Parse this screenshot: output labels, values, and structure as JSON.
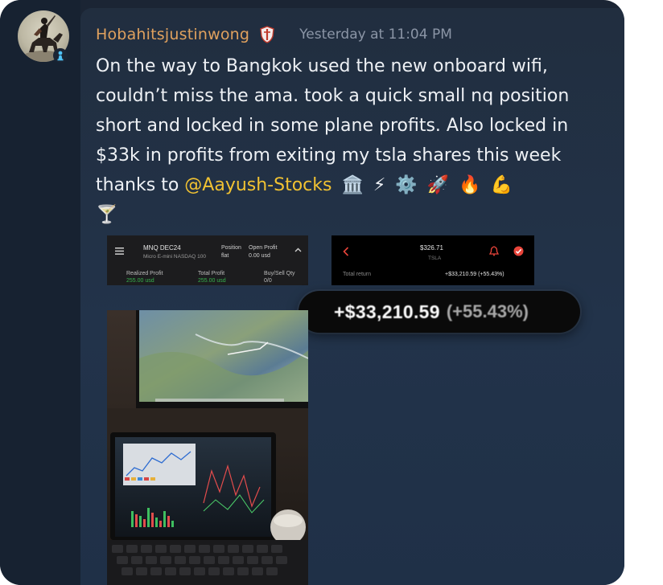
{
  "user": {
    "avatar_icon": "knight-on-horse-avatar",
    "username": "Hobahitsjustinwong",
    "username_color": "#e0a15e",
    "role_badge_icon": "shield-badge-icon",
    "timestamp": "Yesterday at 11:04 PM"
  },
  "message": {
    "text_before_mention": "On the way to Bangkok used the new onboard wifi, couldn’t miss the ama. took a quick small nq position short and locked in some plane profits. Also locked in $33k in profits from exiting my tsla shares this week thanks to ",
    "mention": "@Aayush-Stocks",
    "mention_color": "#f1c232",
    "emojis": [
      "🏛️",
      "⚡",
      "⚙️",
      "🚀",
      "🔥",
      "💪",
      "🍸"
    ]
  },
  "attachment_futures": {
    "menu_icon": "hamburger-menu-icon",
    "symbol": "MNQ DEC24",
    "description": "Micro E-mini NASDAQ 100",
    "position_label": "Position",
    "position_value": "flat",
    "open_profit_label": "Open Profit",
    "open_profit_value": "0.00 usd",
    "realized_label": "Realized Profit",
    "realized_value": "255.00 usd",
    "total_label": "Total Profit",
    "total_value": "255.00 usd",
    "buysell_label": "Buy/Sell Qty",
    "buysell_value": "0/0"
  },
  "attachment_stock": {
    "price": "$326.71",
    "ticker": "TSLA",
    "total_return_label": "Total return",
    "total_return_value": "+$33,210.59 (+55.43%)"
  },
  "zoom_callout": {
    "amount": "+$33,210.59",
    "percent": "(+55.43%)"
  }
}
